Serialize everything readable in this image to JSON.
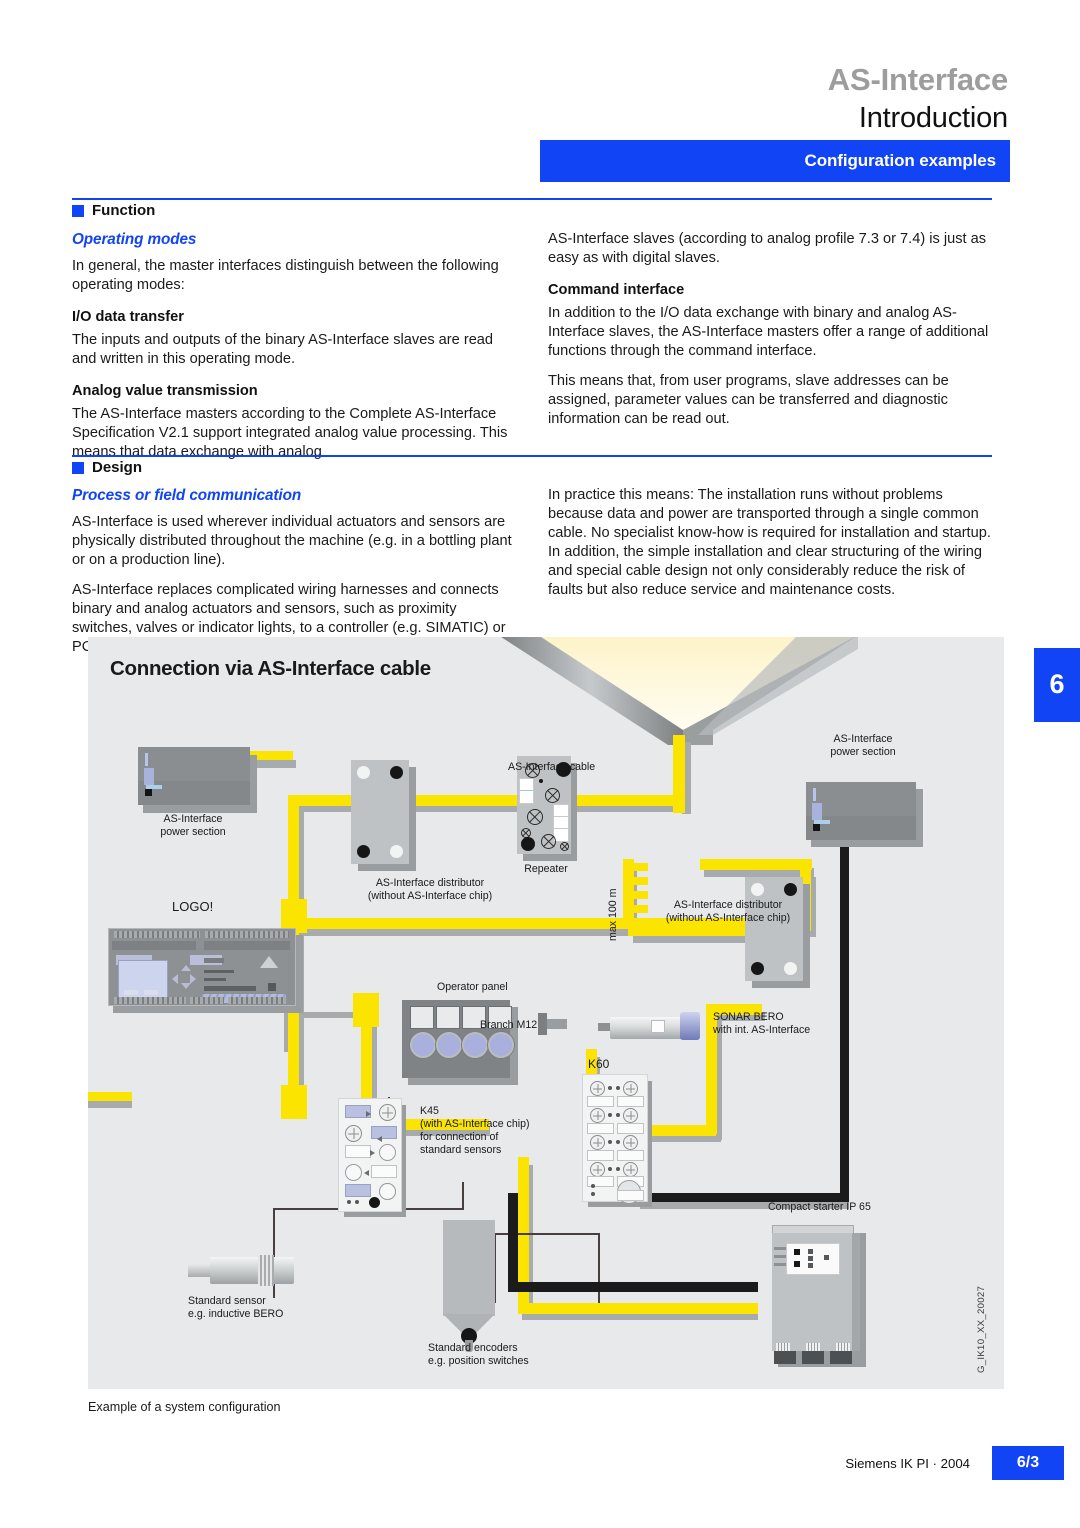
{
  "header": {
    "product": "AS-Interface",
    "section": "Introduction",
    "banner": "Configuration examples"
  },
  "chapter_tab": "6",
  "sections": [
    {
      "name": "Function",
      "left": {
        "sub_italic": "Operating modes",
        "paragraph1": "In general, the master interfaces distinguish between the following operating modes:",
        "sub_bold1": "I/O data transfer",
        "paragraph2": "The inputs and outputs of the binary AS-Interface slaves are read and written in this operating mode.",
        "sub_bold2": "Analog value transmission",
        "paragraph3": "The AS-Interface masters according to the Complete AS-Interface Specification V2.1 support integrated analog value processing. This means that data exchange with analog"
      },
      "right": {
        "paragraph1": "AS-Interface slaves (according to analog profile 7.3 or 7.4) is just as easy as with digital slaves.",
        "sub_bold1": "Command interface",
        "paragraph2": "In addition to the I/O data exchange with binary and analog AS-Interface slaves, the AS-Interface masters offer a range of additional functions through the command interface.",
        "paragraph3": "This means that, from user programs, slave addresses can be assigned, parameter values can be transferred and diagnostic information can be read out."
      }
    },
    {
      "name": "Design",
      "left": {
        "sub_italic": "Process or field communication",
        "paragraph1": "AS-Interface is used wherever individual actuators and sensors are physically distributed throughout the machine (e.g. in a bottling plant or on a production line).",
        "paragraph2": "AS-Interface replaces complicated wiring harnesses and connects binary and analog actuators and sensors, such as proximity switches, valves or indicator lights, to a controller (e.g. SIMATIC) or PC."
      },
      "right": {
        "paragraph1": "In practice this means: The installation runs without problems because data and power are transported through a single common cable. No specialist know-how is required for installation and startup. In addition, the simple installation and clear structuring of the wiring and special cable design not only considerably reduce the risk of faults but also reduce service and maintenance costs."
      }
    }
  ],
  "diagram": {
    "title": "Connection via AS-Interface cable",
    "figure_code": "G_IK10_XX_20027",
    "labels": {
      "power_section_left": "AS-Interface\npower section",
      "power_section_right": "AS-Interface\npower section",
      "as_interface_cable": "AS-Interface cable",
      "distributor_left": "AS-Interface distributor\n(without AS-Interface chip)",
      "distributor_right": "AS-Interface distributor\n(without AS-Interface chip)",
      "repeater": "Repeater",
      "max_length": "max 100 m",
      "logo": "LOGO!",
      "operator_panel": "Operator panel",
      "k45": "K45\n(with AS-Interface chip)\nfor connection of\nstandard sensors",
      "k60": "K60",
      "branch_m12": "Branch M12",
      "sonar_bero": "SONAR BERO\nwith int. AS-Interface",
      "compact_starter": "Compact starter IP 65",
      "standard_sensor": "Standard sensor\ne.g. inductive BERO",
      "standard_encoders": "Standard encoders\ne.g. position switches"
    }
  },
  "caption": "Example of a system configuration",
  "footer": {
    "source": "Siemens IK PI · 2004",
    "page": "6/3"
  },
  "colors": {
    "accent_blue": "#1144f5",
    "cable_yellow": "#fbe500",
    "diagram_bg": "#e7e9ea"
  }
}
